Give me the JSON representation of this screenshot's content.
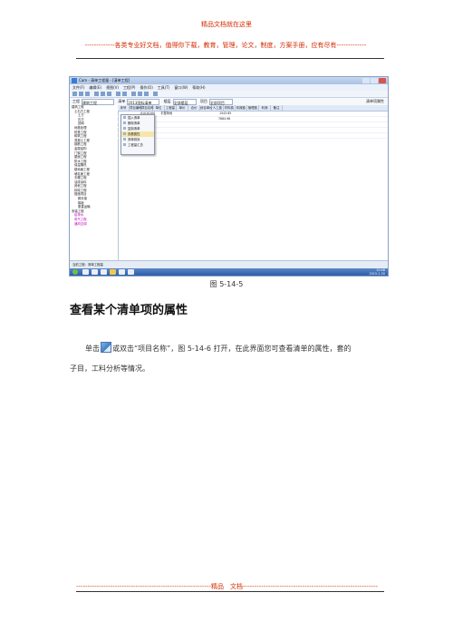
{
  "header": {
    "line1": "精品文档就在这里",
    "line2": "-------------各类专业好文档，值得你下载，教育，管理，论文，制度，方案手册，应有尽有-------------"
  },
  "screenshot": {
    "window_title": "Cam - 清单工程量 - [清单工程]",
    "menus": [
      "文件(F)",
      "编辑(E)",
      "视图(V)",
      "工程(P)",
      "操作(O)",
      "工具(T)",
      "窗口(W)",
      "帮助(H)"
    ],
    "filter": {
      "label1": "工程",
      "value1": "建筑工程",
      "label2": "清单",
      "value2": "2013国标清单",
      "label3": "楼层",
      "value3": "全部楼层",
      "label4": "项目",
      "value4": "全部项目",
      "right_label": "清单项属性"
    },
    "tree_items": [
      {
        "label": "建筑工程",
        "level": 0,
        "selected": false
      },
      {
        "label": "土石方工程",
        "level": 1,
        "selected": false
      },
      {
        "label": "土方",
        "level": 2,
        "selected": false
      },
      {
        "label": "石方",
        "level": 2,
        "selected": false
      },
      {
        "label": "回填",
        "level": 2,
        "selected": false
      },
      {
        "label": "地基处理",
        "level": 1,
        "selected": false
      },
      {
        "label": "桩基工程",
        "level": 1,
        "selected": false
      },
      {
        "label": "砌筑工程",
        "level": 1,
        "selected": false
      },
      {
        "label": "混凝土工程",
        "level": 1,
        "selected": false
      },
      {
        "label": "钢筋工程",
        "level": 1,
        "selected": false
      },
      {
        "label": "金属结构",
        "level": 1,
        "selected": false
      },
      {
        "label": "门窗工程",
        "level": 1,
        "selected": false
      },
      {
        "label": "屋面工程",
        "level": 1,
        "selected": false
      },
      {
        "label": "防水工程",
        "level": 1,
        "selected": false
      },
      {
        "label": "保温隔热",
        "level": 1,
        "selected": false
      },
      {
        "label": "楼地面工程",
        "level": 1,
        "selected": false
      },
      {
        "label": "墙柱面工程",
        "level": 1,
        "selected": false
      },
      {
        "label": "天棚工程",
        "level": 1,
        "selected": false
      },
      {
        "label": "油漆涂料",
        "level": 1,
        "selected": false
      },
      {
        "label": "其他工程",
        "level": 1,
        "selected": false
      },
      {
        "label": "拆除工程",
        "level": 1,
        "selected": false
      },
      {
        "label": "措施项目",
        "level": 1,
        "selected": false
      },
      {
        "label": "脚手架",
        "level": 2,
        "selected": false
      },
      {
        "label": "模板",
        "level": 2,
        "selected": false
      },
      {
        "label": "垂直运输",
        "level": 2,
        "selected": false
      },
      {
        "label": "安装工程",
        "level": 0,
        "selected": false
      },
      {
        "label": "给排水",
        "level": 1,
        "selected": true
      },
      {
        "label": "电气工程",
        "level": 1,
        "selected": true
      },
      {
        "label": "通风空调",
        "level": 1,
        "selected": true
      }
    ],
    "grid_headers": [
      "序号",
      "项目编码",
      "项目名称",
      "单位",
      "工程量",
      "单价",
      "合价",
      "综合单价",
      "人工费",
      "材料费",
      "机械费",
      "管理费",
      "利润",
      "备注"
    ],
    "grid_rows": [
      {
        "code": "01010100",
        "name": "平整场地",
        "amount": "1543.85"
      },
      {
        "code": "",
        "name": "",
        "amount": "7684.98"
      }
    ],
    "context_menu": [
      "插入清单",
      "删除清单",
      "复制清单",
      "查看属性",
      "清单排序",
      "工程量汇总"
    ],
    "status": "当前工程：清单工程量",
    "taskbar_time": "10:48",
    "taskbar_date": "2015-1-30"
  },
  "caption": "图 5-14-5",
  "heading": "查看某个清单项的属性",
  "paragraph": {
    "part1": "单击",
    "part2": "或双击“项目名称”，图 5-14-6 打开，在此界面您可查看清单的属性，套的",
    "line2": "子目，工料分析等情况。"
  },
  "footer": "-----------------------------------------------------------精品　文档-----------------------------------------------------------"
}
